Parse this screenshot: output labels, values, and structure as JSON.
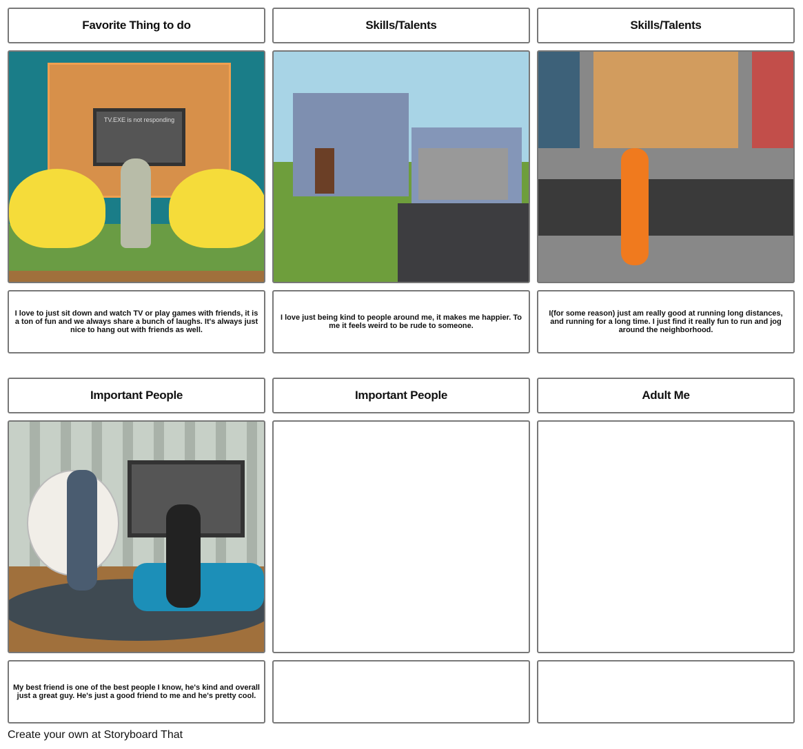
{
  "cells": [
    {
      "title": "Favorite Thing to do",
      "description": "I love to just sit down and watch TV or play games with friends, it is a ton of fun and we always share a bunch of laughs. It's always just nice to hang out with friends as well.",
      "scene_text": "TV.EXE is not responding"
    },
    {
      "title": "Skills/Talents",
      "description": "I love just being kind to people around me, it makes me happier. To me it feels weird to be rude to someone."
    },
    {
      "title": "Skills/Talents",
      "description": "I(for some reason) just am really good at running long distances, and running for a long time. I just find it really fun to run and jog around the neighborhood."
    },
    {
      "title": "Important People",
      "description": "My best friend is one of the best people I know, he's kind and overall just a great guy. He's just a good friend to me and he's pretty cool."
    },
    {
      "title": "Important People",
      "description": ""
    },
    {
      "title": "Adult Me",
      "description": ""
    }
  ],
  "footer": "Create your own at Storyboard That"
}
